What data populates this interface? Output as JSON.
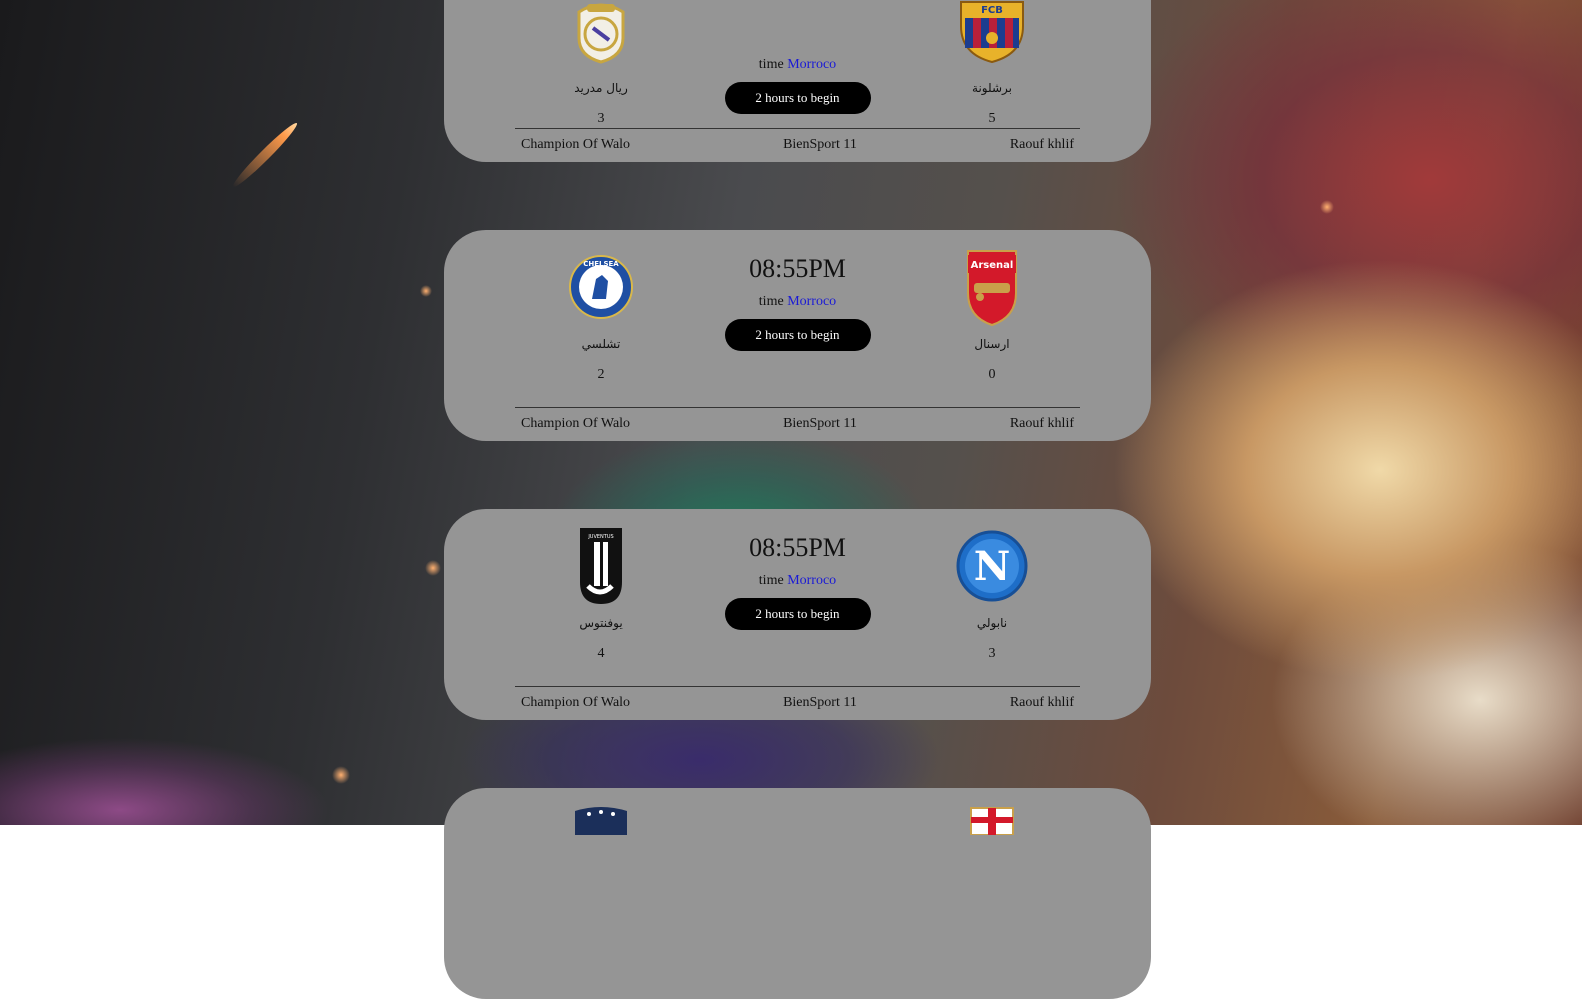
{
  "matches": [
    {
      "kickoff": "",
      "timezone_label": "time",
      "timezone_link": "Morroco",
      "countdown": "2 hours to begin",
      "home": {
        "name": "ريال مدريد",
        "score": "3",
        "logo": "real-madrid-logo",
        "logo_text": ""
      },
      "away": {
        "name": "برشلونة",
        "score": "5",
        "logo": "barcelona-logo",
        "logo_text": "FCB"
      },
      "footer": {
        "left": "Champion Of Walo",
        "center": "BienSport 11",
        "right": "Raouf khlif"
      }
    },
    {
      "kickoff": "08:55PM",
      "timezone_label": "time",
      "timezone_link": "Morroco",
      "countdown": "2 hours to begin",
      "home": {
        "name": "تشلسي",
        "score": "2",
        "logo": "chelsea-logo",
        "logo_text": "CHELSEA"
      },
      "away": {
        "name": "ارسنال",
        "score": "0",
        "logo": "arsenal-logo",
        "logo_text": "Arsenal"
      },
      "footer": {
        "left": "Champion Of Walo",
        "center": "BienSport 11",
        "right": "Raouf khlif"
      }
    },
    {
      "kickoff": "08:55PM",
      "timezone_label": "time",
      "timezone_link": "Morroco",
      "countdown": "2 hours to begin",
      "home": {
        "name": "يوفنتوس",
        "score": "4",
        "logo": "juventus-logo",
        "logo_text": "JUVENTUS"
      },
      "away": {
        "name": "نابولي",
        "score": "3",
        "logo": "napoli-logo",
        "logo_text": "N"
      },
      "footer": {
        "left": "Champion Of Walo",
        "center": "BienSport 11",
        "right": "Raouf khlif"
      }
    },
    {
      "kickoff": "",
      "timezone_label": "",
      "timezone_link": "",
      "countdown": "",
      "home": {
        "name": "",
        "score": "",
        "logo": "psg-logo",
        "logo_text": ""
      },
      "away": {
        "name": "",
        "score": "",
        "logo": "england-logo",
        "logo_text": ""
      },
      "footer": {
        "left": "",
        "center": "",
        "right": ""
      }
    }
  ],
  "colors": {
    "card": "#959595",
    "countdown_bg": "#000000",
    "link": "#1a1ad6",
    "madrid_gold": "#c8a640",
    "barca_blue": "#1c3d8f",
    "barca_red": "#b8203a",
    "chelsea_blue": "#1f4fa3",
    "arsenal_red": "#d3192a",
    "napoli_blue": "#1e6ec8"
  }
}
